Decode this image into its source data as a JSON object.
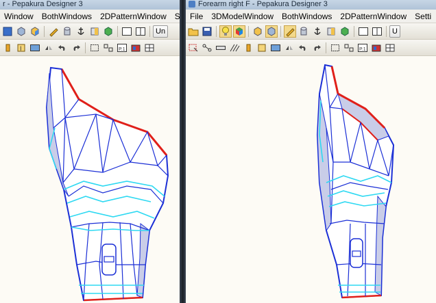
{
  "left_window": {
    "title": "r - Pepakura Designer 3",
    "menu": [
      "Window",
      "BothWindows",
      "2DPatternWindow",
      "Setti"
    ],
    "toolbar_button_label": "Un"
  },
  "right_window": {
    "title": "Forearm right F - Pepakura Designer 3",
    "menu": [
      "File",
      "3DModelWindow",
      "BothWindows",
      "2DPatternWindow",
      "Setti"
    ],
    "toolbar_button_label": "U"
  },
  "colors": {
    "background": "#fdfbf5",
    "edge_blue": "#1b2fd6",
    "edge_cyan": "#2ed9f2",
    "edge_red": "#e0201a",
    "face_shadow": "#c9cde8"
  }
}
